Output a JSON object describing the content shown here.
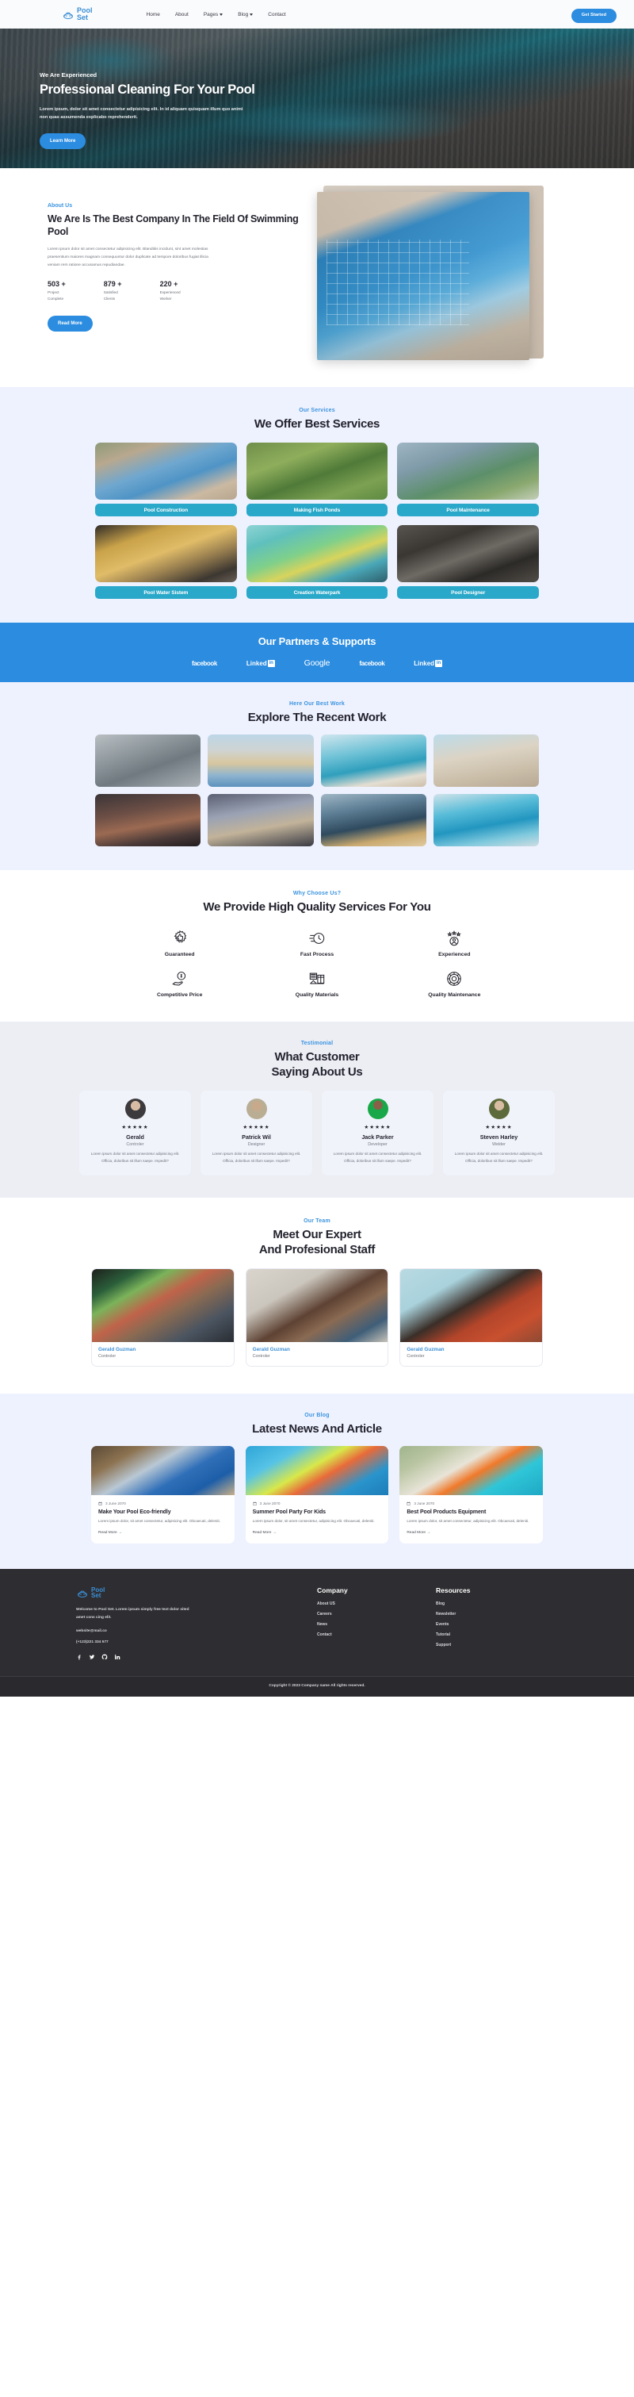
{
  "brand": {
    "line1": "Pool",
    "line2": "Set",
    "logo_icon": "pool-logo-icon"
  },
  "nav": {
    "links": [
      {
        "label": "Home",
        "caret": false
      },
      {
        "label": "About",
        "caret": false
      },
      {
        "label": "Pages",
        "caret": true
      },
      {
        "label": "Blog",
        "caret": true
      },
      {
        "label": "Contact",
        "caret": false
      }
    ],
    "cta_label": "Get Started"
  },
  "hero": {
    "eyebrow": "We Are Experienced",
    "title": "Professional Cleaning For Your Pool",
    "description": "Lorem ipsum, dolor sit amet consectetur adipisicing elit. In id aliquam quisquam illum quo animi non quas assumenda explicabo reprehenderit.",
    "button_label": "Learn More"
  },
  "about": {
    "eyebrow": "About Us",
    "title": "We Are Is The Best Company In The Field Of Swimming Pool",
    "description": "Lorem ipsum dolor sit amet consectetur adipisicing elit. Blanditiis incidunt, sint amet molestias praesentium maiores magnam consequuntur dolor duplicate ad tempore doloribus fugiat illicia veniam rem ratione accusamus repudiandae.",
    "stats": [
      {
        "value": "503 +",
        "label1": "Project",
        "label2": "Complete"
      },
      {
        "value": "879 +",
        "label1": "Satisfied",
        "label2": "Clients"
      },
      {
        "value": "220 +",
        "label1": "Experienced",
        "label2": "Worker"
      }
    ],
    "button_label": "Read More"
  },
  "services": {
    "eyebrow": "Our Services",
    "title": "We Offer Best Services",
    "items": [
      {
        "label": "Pool Construction"
      },
      {
        "label": "Making Fish Ponds"
      },
      {
        "label": "Pool Maintenance"
      },
      {
        "label": "Pool Water Sistem"
      },
      {
        "label": "Creation Waterpark"
      },
      {
        "label": "Pool Designer"
      }
    ]
  },
  "partners": {
    "title": "Our Partners & Supports",
    "logos": [
      "facebook",
      "LinkedIn",
      "Google",
      "facebook",
      "LinkedIn"
    ]
  },
  "portfolio": {
    "eyebrow": "Here Our Best Work",
    "title": "Explore The Recent Work",
    "items": 8
  },
  "features": {
    "eyebrow": "Why Choose Us?",
    "title": "We Provide High Quality Services For You",
    "items": [
      {
        "label": "Guaranteed",
        "icon": "badge-thumbs-up-icon"
      },
      {
        "label": "Fast Process",
        "icon": "fast-clock-icon"
      },
      {
        "label": "Experienced",
        "icon": "user-stars-icon"
      },
      {
        "label": "Competitive Price",
        "icon": "hand-price-tag-icon"
      },
      {
        "label": "Quality Materials",
        "icon": "materials-box-icon"
      },
      {
        "label": "Quality Maintenance",
        "icon": "gear-fingerprint-icon"
      }
    ]
  },
  "testimonial": {
    "eyebrow": "Testimonial",
    "title": "What Customer Saying About Us",
    "stars": "★★★★★",
    "items": [
      {
        "name": "Gerald",
        "role": "Controler",
        "text": "Lorem ipsum dolor sit amet consectetur adipisicing elit. Officia, doloribus sit illum saepe. Impedit?"
      },
      {
        "name": "Patrick Wil",
        "role": "Designer",
        "text": "Lorem ipsum dolor sit amet consectetur adipisicing elit. Officia, doloribus sit illum saepe. Impedit?"
      },
      {
        "name": "Jack Parker",
        "role": "Developer",
        "text": "Lorem ipsum dolor sit amet consectetur adipisicing elit. Officia, doloribus sit illum saepe. Impedit?"
      },
      {
        "name": "Steven Harley",
        "role": "Welder",
        "text": "Lorem ipsum dolor sit amet consectetur adipisicing elit. Officia, doloribus sit illum saepe. Impedit?"
      }
    ]
  },
  "team": {
    "eyebrow": "Our Team",
    "title": "Meet Our Expert And Profesional Staff",
    "items": [
      {
        "name": "Gerald Guzman",
        "role": "Controler"
      },
      {
        "name": "Gerald Guzman",
        "role": "Controler"
      },
      {
        "name": "Gerald Guzman",
        "role": "Controler"
      }
    ]
  },
  "blog": {
    "eyebrow": "Our Blog",
    "title": "Latest News And Article",
    "items": [
      {
        "date": "3 June 2070",
        "title": "Make Your Pool Eco-friendly",
        "desc": "Lorem ipsum dolor, sit amet consectetur, adipisicing elit. Obcaecati, deleniti.",
        "more": "Read More →"
      },
      {
        "date": "3 June 2070",
        "title": "Summer Pool Party For Kids",
        "desc": "Lorem ipsum dolor, sit amet consectetur, adipisicing elit. Obcaecati, deleniti.",
        "more": "Read More →"
      },
      {
        "date": "3 June 2070",
        "title": "Best Pool Products Equipment",
        "desc": "Lorem ipsum dolor, sit amet consectetur, adipisicing elit. Obcaecati, deleniti.",
        "more": "Read More →"
      }
    ]
  },
  "footer": {
    "description": "Welcome to Pool Set. Lorem ipsum simply free text dolor sited amet cons cing elit.",
    "email": "website@mail.co",
    "phone": "(+123)221 334 577",
    "socials": [
      "facebook-icon",
      "twitter-icon",
      "github-icon",
      "linkedin-icon"
    ],
    "columns": [
      {
        "heading": "Company",
        "links": [
          "About US",
          "Careers",
          "News",
          "Contact"
        ]
      },
      {
        "heading": "Resources",
        "links": [
          "Blog",
          "Newsletter",
          "Events",
          "Tutorial",
          "Support"
        ]
      }
    ],
    "copyright": "Copyright © 2023 Company name All rights reserved."
  },
  "colors": {
    "brand_blue": "#2b8ce0",
    "teal": "#2aa8c9",
    "light_bg": "#eef1fe",
    "dark": "#2e2e32"
  }
}
